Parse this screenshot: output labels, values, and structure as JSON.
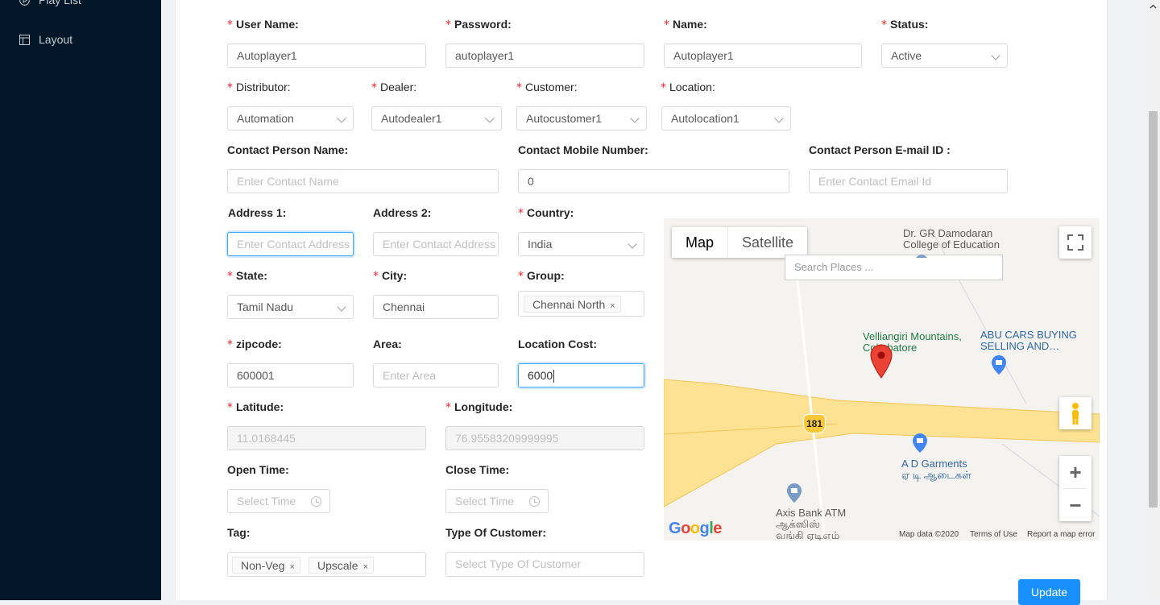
{
  "sidebar": {
    "items": [
      {
        "label": "Play List",
        "icon": "play-circle-icon"
      },
      {
        "label": "Layout",
        "icon": "layout-icon"
      }
    ]
  },
  "form": {
    "username": {
      "label": "User Name",
      "value": "Autoplayer1"
    },
    "password": {
      "label": "Password",
      "value": "autoplayer1"
    },
    "name": {
      "label": "Name",
      "value": "Autoplayer1"
    },
    "status": {
      "label": "Status",
      "value": "Active"
    },
    "distributor": {
      "label": "Distributor",
      "value": "Automation"
    },
    "dealer": {
      "label": "Dealer",
      "value": "Autodealer1"
    },
    "customer": {
      "label": "Customer",
      "value": "Autocustomer1"
    },
    "location": {
      "label": "Location",
      "value": "Autolocation1"
    },
    "contact_name": {
      "label": "Contact Person Name",
      "placeholder": "Enter Contact Name"
    },
    "contact_mobile": {
      "label": "Contact Mobile Number",
      "value": "0"
    },
    "contact_email": {
      "label": "Contact Person E-mail ID",
      "placeholder": "Enter Contact Email Id"
    },
    "address1": {
      "label": "Address 1",
      "placeholder": "Enter Contact Address"
    },
    "address2": {
      "label": "Address 2",
      "placeholder": "Enter Contact Address"
    },
    "country": {
      "label": "Country",
      "value": "India"
    },
    "state": {
      "label": "State",
      "value": "Tamil Nadu"
    },
    "city": {
      "label": "City",
      "value": "Chennai"
    },
    "group": {
      "label": "Group",
      "tags": [
        "Chennai North"
      ]
    },
    "zipcode": {
      "label": "zipcode",
      "value": "600001"
    },
    "area": {
      "label": "Area",
      "placeholder": "Enter Area"
    },
    "location_cost": {
      "label": "Location Cost",
      "value": "6000"
    },
    "latitude": {
      "label": "Latitude",
      "value": "11.0168445"
    },
    "longitude": {
      "label": "Longitude",
      "value": "76.95583209999995"
    },
    "open_time": {
      "label": "Open Time",
      "placeholder": "Select Time"
    },
    "close_time": {
      "label": "Close Time",
      "placeholder": "Select Time"
    },
    "tag": {
      "label": "Tag",
      "tags": [
        "Non-Veg",
        "Upscale"
      ]
    },
    "type_of_customer": {
      "label": "Type Of Customer",
      "placeholder": "Select Type Of Customer"
    },
    "colon": ":",
    "required_mark": "*",
    "tag_remove": "×"
  },
  "map": {
    "type_map": "Map",
    "type_satellite": "Satellite",
    "search_placeholder": "Search Places ...",
    "route_number": "181",
    "pois": {
      "college": [
        "Dr. GR Damodaran",
        "College of Education"
      ],
      "mountains": [
        "Velliangiri Mountains,",
        "Coimbatore"
      ],
      "abu": [
        "ABU CARS BUYING",
        "SELLING AND…"
      ],
      "garments": [
        "A D Garments",
        "ஏ டி ஆடைகள்"
      ],
      "atm": [
        "Axis Bank ATM",
        "ஆக்ஸிஸ்",
        "வங்கி ஏடிஎம்"
      ]
    },
    "logo": "Google",
    "footer": {
      "data": "Map data ©2020",
      "terms": "Terms of Use",
      "report": "Report a map error"
    },
    "zoom_in": "+",
    "zoom_out": "−"
  },
  "actions": {
    "update": "Update"
  },
  "colors": {
    "primary": "#1890ff",
    "sidebar": "#011628",
    "required": "#f5222d",
    "marker": "#ea4335"
  }
}
